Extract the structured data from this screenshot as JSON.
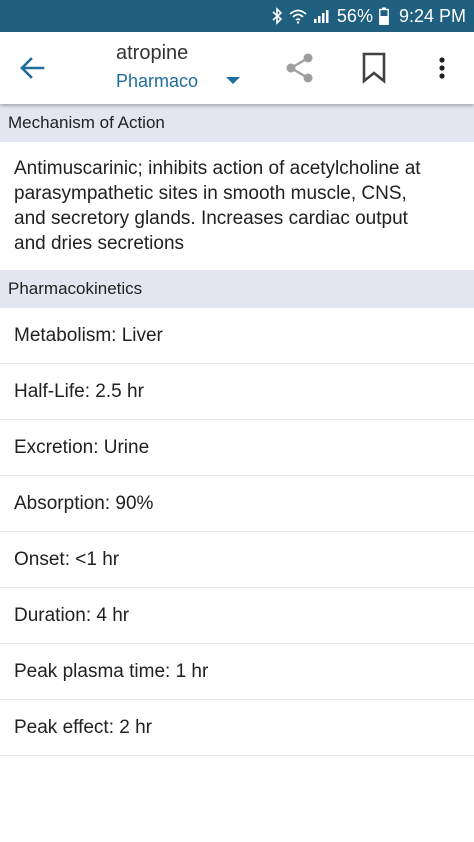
{
  "status_bar": {
    "battery": "56%",
    "time": "9:24 PM",
    "icons": [
      "bluetooth-icon",
      "wifi-icon",
      "signal-icon",
      "battery-icon"
    ]
  },
  "app_bar": {
    "title": "atropine",
    "subtitle": "Pharmaco",
    "icons": [
      "back-arrow-icon",
      "dropdown-arrow-icon",
      "share-icon",
      "bookmark-icon",
      "more-vert-icon"
    ],
    "accent_color": "#1f6d9c"
  },
  "sections": {
    "mechanism": {
      "header": "Mechanism of Action",
      "text": "Antimuscarinic; inhibits action of acetylcholine at parasympathetic sites in smooth muscle, CNS, and secretory glands. Increases cardiac output and dries secretions"
    },
    "pharmacokinetics": {
      "header": "Pharmacokinetics",
      "rows": [
        "Metabolism: Liver",
        "Half-Life: 2.5 hr",
        "Excretion: Urine",
        "Absorption: 90%",
        "Onset: <1 hr",
        "Duration: 4 hr",
        "Peak plasma time: 1 hr",
        "Peak effect: 2 hr"
      ]
    }
  }
}
